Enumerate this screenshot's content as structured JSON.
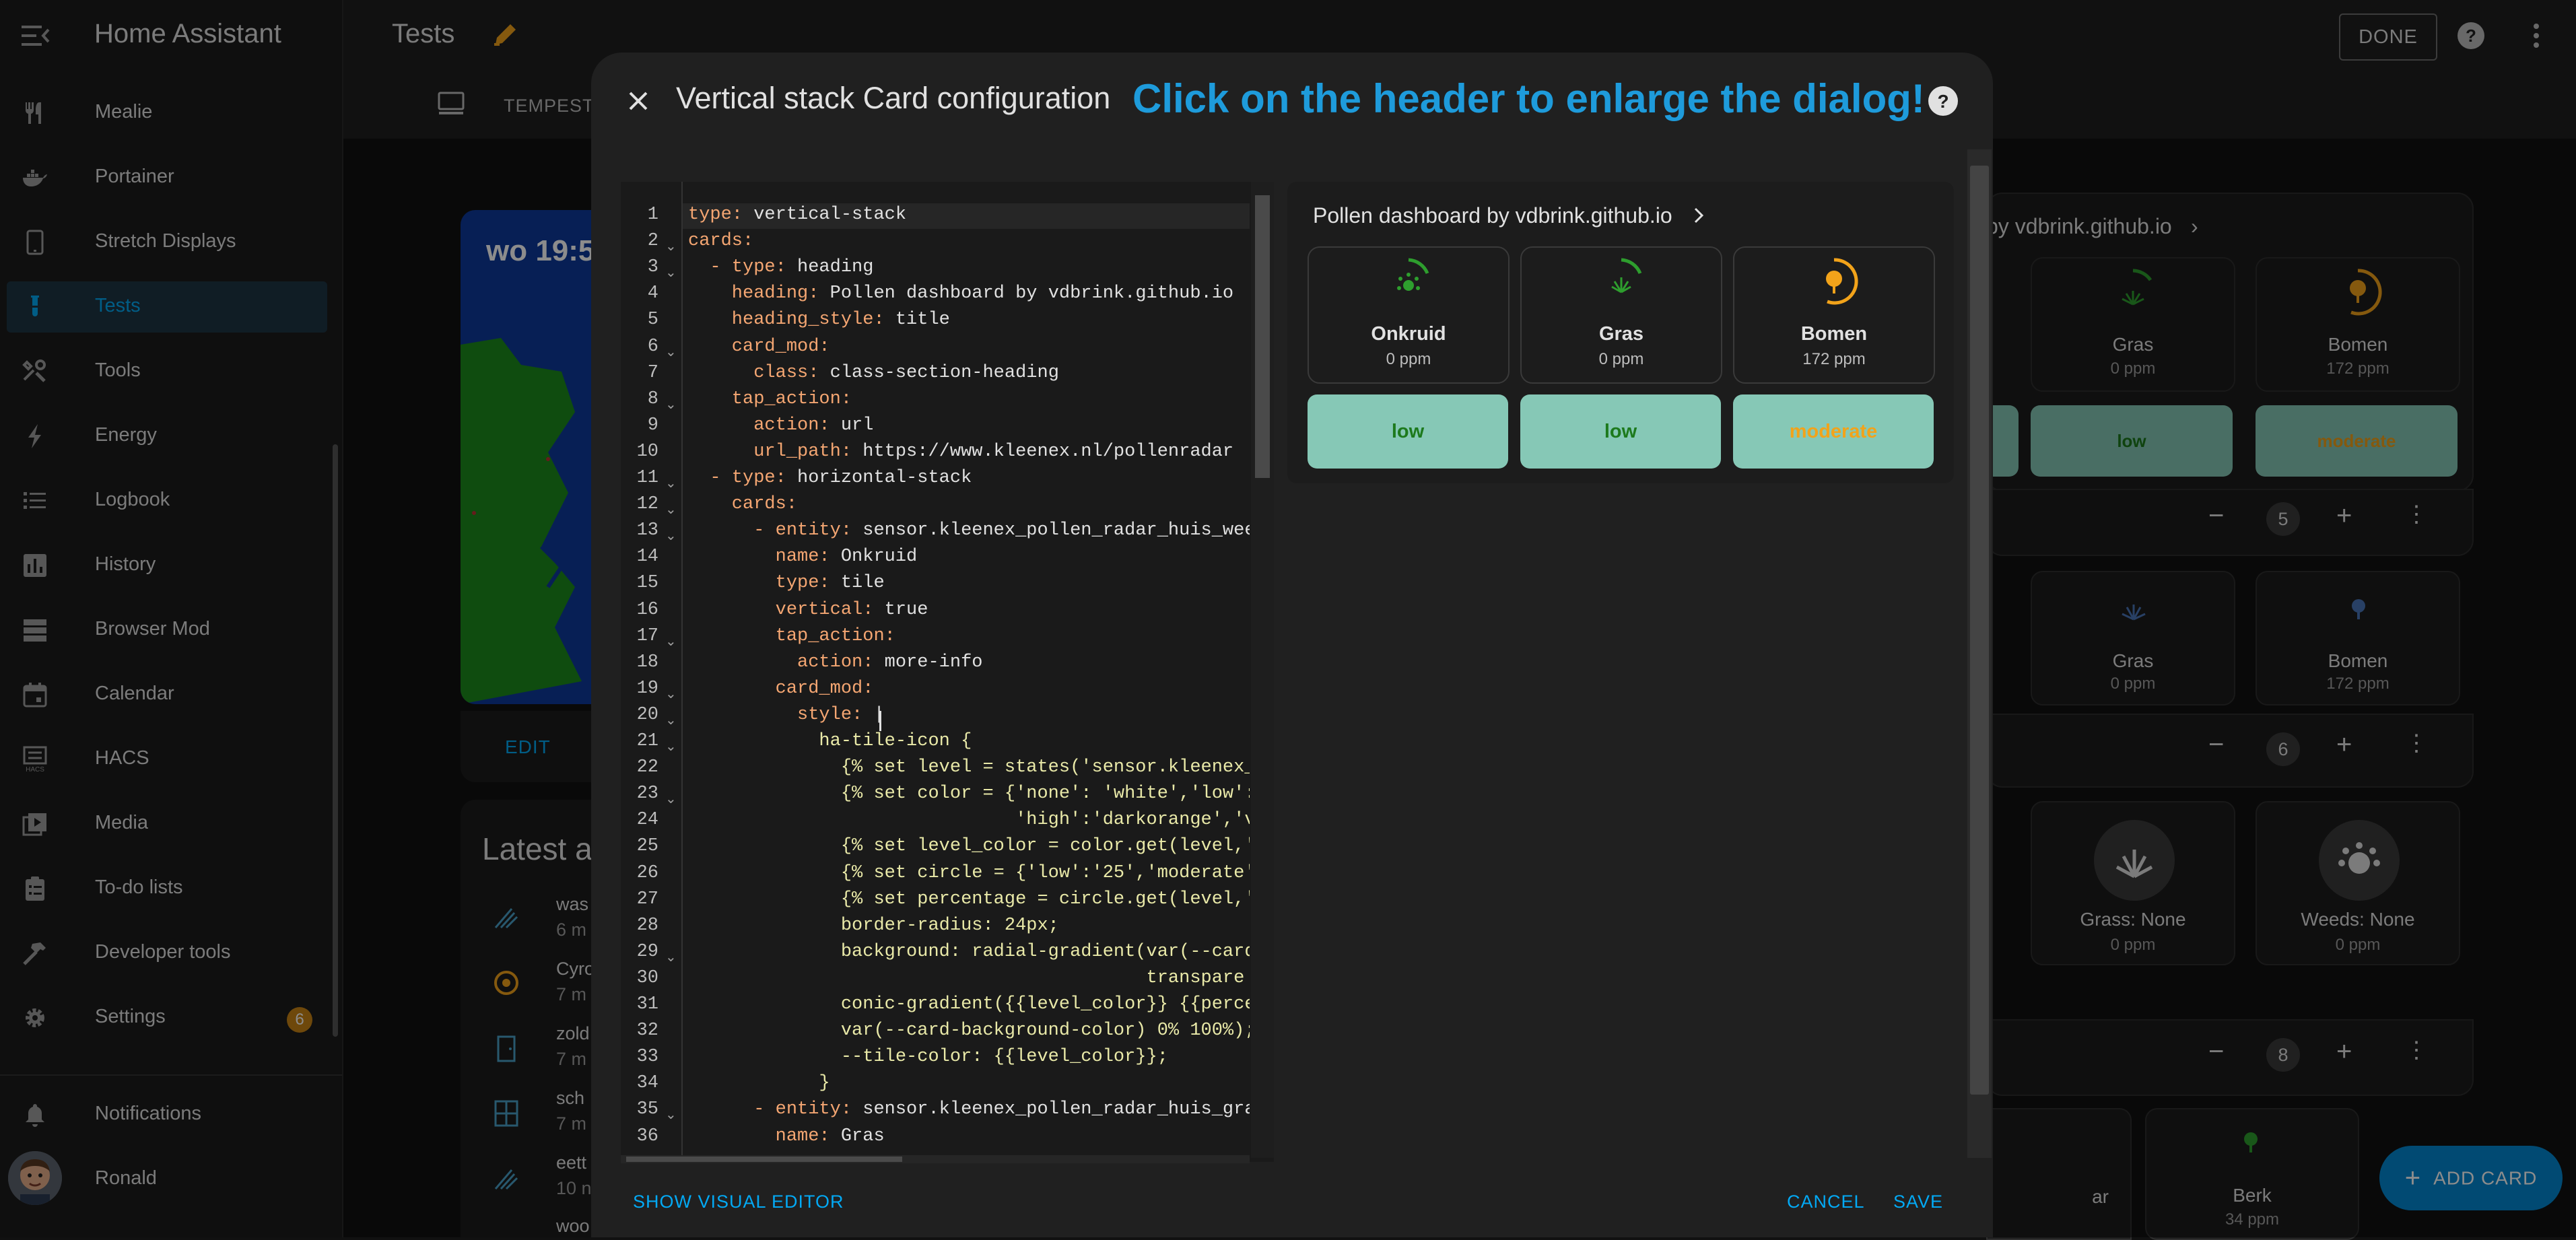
{
  "app": {
    "title": "Home Assistant",
    "user": "Ronald"
  },
  "sidebar": {
    "items": [
      {
        "label": "Mealie",
        "icon": "silverware-icon"
      },
      {
        "label": "Portainer",
        "icon": "docker-whale-icon"
      },
      {
        "label": "Stretch Displays",
        "icon": "tablet-icon"
      },
      {
        "label": "Tests",
        "icon": "test-tube-icon",
        "active": true
      },
      {
        "label": "Tools",
        "icon": "tools-icon"
      },
      {
        "label": "Energy",
        "icon": "lightning-icon"
      },
      {
        "label": "Logbook",
        "icon": "list-icon"
      },
      {
        "label": "History",
        "icon": "chart-bar-icon"
      },
      {
        "label": "Browser Mod",
        "icon": "server-icon"
      },
      {
        "label": "Calendar",
        "icon": "calendar-icon"
      },
      {
        "label": "HACS",
        "icon": "hacs-icon"
      },
      {
        "label": "Media",
        "icon": "play-box-icon"
      },
      {
        "label": "To-do lists",
        "icon": "clipboard-list-icon"
      },
      {
        "label": "Developer tools",
        "icon": "hammer-icon"
      },
      {
        "label": "Settings",
        "icon": "cog-icon",
        "badge": "6"
      }
    ],
    "notifications": "Notifications"
  },
  "header": {
    "title": "Tests",
    "done": "DONE",
    "tab": "TEMPEST"
  },
  "background": {
    "map_time": "wo 19:5",
    "edit": "EDIT",
    "latest_title": "Latest a",
    "activity": [
      {
        "title": "was",
        "time": "6 m"
      },
      {
        "title": "Cyro",
        "time": "7 m"
      },
      {
        "title": "zold",
        "time": "7 m"
      },
      {
        "title": "sch",
        "time": "7 m"
      },
      {
        "title": "eett",
        "time": "10 n"
      },
      {
        "title": "woo",
        "time": ""
      }
    ],
    "heading_fragment": "by vdbrink.github.io",
    "tiles_row1": [
      {
        "name": "Gras",
        "value": "0 ppm"
      },
      {
        "name": "Bomen",
        "value": "172 ppm"
      }
    ],
    "levels_row1": [
      "low",
      "moderate"
    ],
    "counter5": "5",
    "tiles_row2": [
      {
        "name": "Gras",
        "value": "0 ppm"
      },
      {
        "name": "Bomen",
        "value": "172 ppm"
      }
    ],
    "counter6": "6",
    "tiles_row3": [
      {
        "name": "Grass: None",
        "value": "0 ppm"
      },
      {
        "name": "Weeds: None",
        "value": "0 ppm"
      }
    ],
    "counter8": "8",
    "tile_fragment": "ar",
    "tiles_row4": [
      {
        "name": "Berk",
        "value": "34 ppm"
      }
    ],
    "add_card": "ADD CARD"
  },
  "dialog": {
    "title": "Vertical stack Card configuration",
    "hint": "Click on the header to enlarge the dialog!",
    "show_visual_editor": "SHOW VISUAL EDITOR",
    "cancel": "CANCEL",
    "save": "SAVE"
  },
  "editor": {
    "lines": [
      {
        "n": "1",
        "k": "type: ",
        "v": "vertical-stack"
      },
      {
        "n": "2",
        "k": "cards:",
        "v": "",
        "fold": true
      },
      {
        "n": "3",
        "k": "  - type: ",
        "v": "heading",
        "fold": true
      },
      {
        "n": "4",
        "k": "    heading: ",
        "v": "Pollen dashboard by vdbrink.github.io"
      },
      {
        "n": "5",
        "k": "    heading_style: ",
        "v": "title"
      },
      {
        "n": "6",
        "k": "    card_mod:",
        "v": "",
        "fold": true
      },
      {
        "n": "7",
        "k": "      class: ",
        "v": "class-section-heading"
      },
      {
        "n": "8",
        "k": "    tap_action:",
        "v": "",
        "fold": true
      },
      {
        "n": "9",
        "k": "      action: ",
        "v": "url"
      },
      {
        "n": "10",
        "k": "      url_path: ",
        "v": "https://www.kleenex.nl/pollenradar"
      },
      {
        "n": "11",
        "k": "  - type: ",
        "v": "horizontal-stack",
        "fold": true
      },
      {
        "n": "12",
        "k": "    cards:",
        "v": "",
        "fold": true
      },
      {
        "n": "13",
        "k": "      - entity: ",
        "v": "sensor.kleenex_pollen_radar_huis_wee",
        "fold": true
      },
      {
        "n": "14",
        "k": "        name: ",
        "v": "Onkruid"
      },
      {
        "n": "15",
        "k": "        type: ",
        "v": "tile"
      },
      {
        "n": "16",
        "k": "        vertical: ",
        "v": "true"
      },
      {
        "n": "17",
        "k": "        tap_action:",
        "v": "",
        "fold": true
      },
      {
        "n": "18",
        "k": "          action: ",
        "v": "more-info"
      },
      {
        "n": "19",
        "k": "        card_mod:",
        "v": "",
        "fold": true
      },
      {
        "n": "20",
        "k": "          style: ",
        "v": "|",
        "fold": true
      },
      {
        "n": "21",
        "k": "",
        "s": "            ha-tile-icon {",
        "fold": true
      },
      {
        "n": "22",
        "k": "",
        "s": "              {% set level = states('sensor.kleenex_"
      },
      {
        "n": "23",
        "k": "",
        "s": "              {% set color = {'none': 'white','low':",
        "fold": true
      },
      {
        "n": "24",
        "k": "",
        "s": "                              'high':'darkorange','v"
      },
      {
        "n": "25",
        "k": "",
        "s": "              {% set level_color = color.get(level,'"
      },
      {
        "n": "26",
        "k": "",
        "s": "              {% set circle = {'low':'25','moderate'"
      },
      {
        "n": "27",
        "k": "",
        "s": "              {% set percentage = circle.get(level,'"
      },
      {
        "n": "28",
        "k": "",
        "s": "              border-radius: 24px;"
      },
      {
        "n": "29",
        "k": "",
        "s": "              background: radial-gradient(var(--card",
        "fold": true
      },
      {
        "n": "30",
        "k": "",
        "s": "                                          transpare"
      },
      {
        "n": "31",
        "k": "",
        "s": "              conic-gradient({{level_color}} {{perce"
      },
      {
        "n": "32",
        "k": "",
        "s": "              var(--card-background-color) 0% 100%);"
      },
      {
        "n": "33",
        "k": "",
        "s": "              --tile-color: {{level_color}};"
      },
      {
        "n": "34",
        "k": "",
        "s": "            }"
      },
      {
        "n": "35",
        "k": "      - entity: ",
        "v": "sensor.kleenex_pollen_radar_huis_gra",
        "fold": true
      },
      {
        "n": "36",
        "k": "        name: ",
        "v": "Gras"
      }
    ]
  },
  "preview": {
    "heading": "Pollen dashboard by vdbrink.github.io",
    "tiles": [
      {
        "name": "Onkruid",
        "value": "0 ppm",
        "icon": "flower-pollen-icon",
        "color": "#2e9e2e"
      },
      {
        "name": "Gras",
        "value": "0 ppm",
        "icon": "grass-icon",
        "color": "#2e9e2e"
      },
      {
        "name": "Bomen",
        "value": "172 ppm",
        "icon": "tree-icon",
        "color": "#f2a31a"
      }
    ],
    "levels": [
      {
        "text": "low",
        "color": "#1d7a1d"
      },
      {
        "text": "low",
        "color": "#1d7a1d"
      },
      {
        "text": "moderate",
        "color": "#f2a31a"
      }
    ]
  },
  "colors": {
    "accent": "#03a9f4",
    "hint": "#1e9bdb",
    "level_bg": "#86c8b6",
    "orange": "#f2a31a",
    "green": "#2e9e2e"
  }
}
